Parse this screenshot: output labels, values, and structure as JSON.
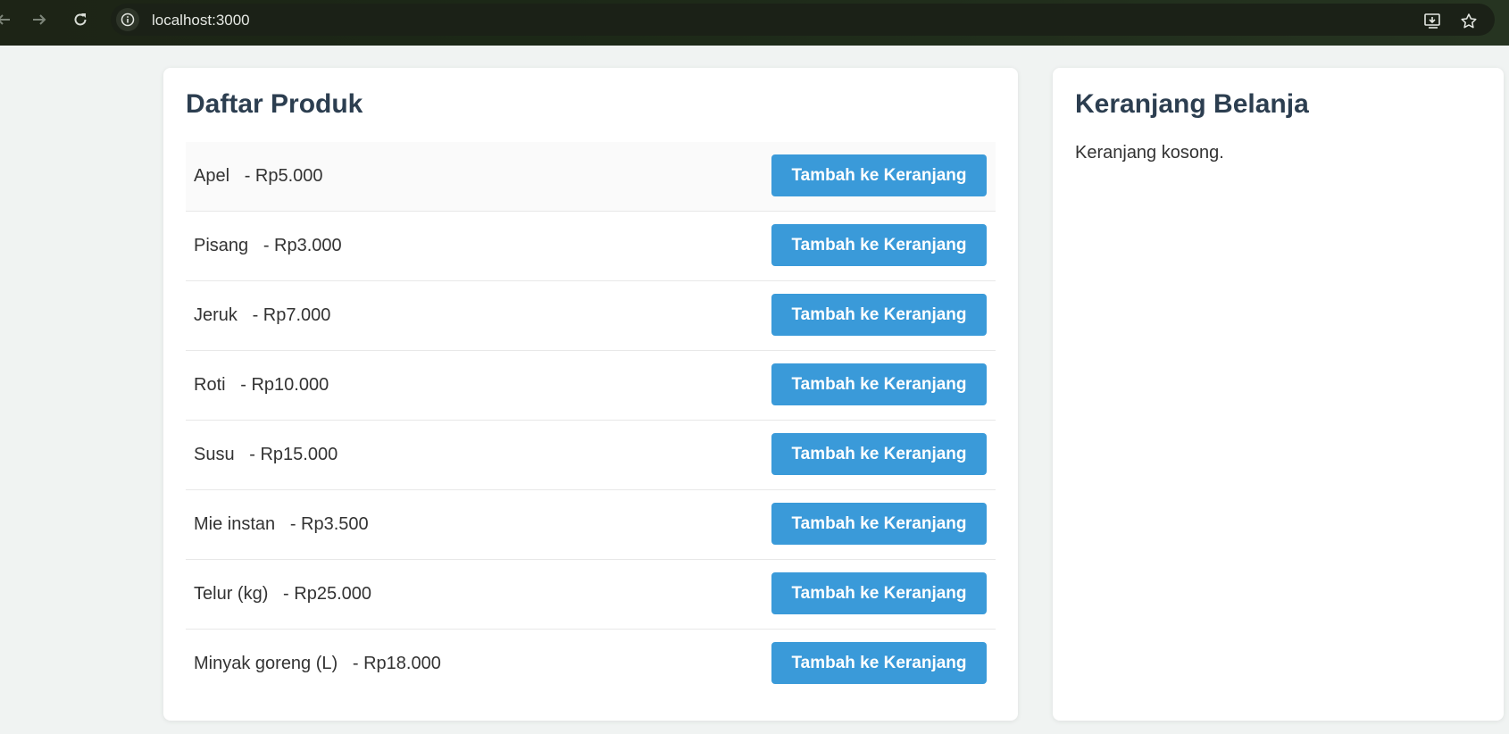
{
  "browser": {
    "url": "localhost:3000"
  },
  "products_panel": {
    "title": "Daftar Produk",
    "add_label": "Tambah ke Keranjang",
    "items": [
      {
        "name": "Apel",
        "price": "Rp5.000"
      },
      {
        "name": "Pisang",
        "price": "Rp3.000"
      },
      {
        "name": "Jeruk",
        "price": "Rp7.000"
      },
      {
        "name": "Roti",
        "price": "Rp10.000"
      },
      {
        "name": "Susu",
        "price": "Rp15.000"
      },
      {
        "name": "Mie instan",
        "price": "Rp3.500"
      },
      {
        "name": "Telur (kg)",
        "price": "Rp25.000"
      },
      {
        "name": "Minyak goreng (L)",
        "price": "Rp18.000"
      }
    ]
  },
  "cart_panel": {
    "title": "Keranjang Belanja",
    "empty_text": "Keranjang kosong."
  },
  "colors": {
    "button": "#3a9ad9",
    "heading": "#2c3e50",
    "browser_bar": "#1d2416"
  },
  "icons": [
    "back-arrow-icon",
    "forward-arrow-icon",
    "reload-icon",
    "site-info-icon",
    "install-app-icon",
    "bookmark-star-icon"
  ]
}
